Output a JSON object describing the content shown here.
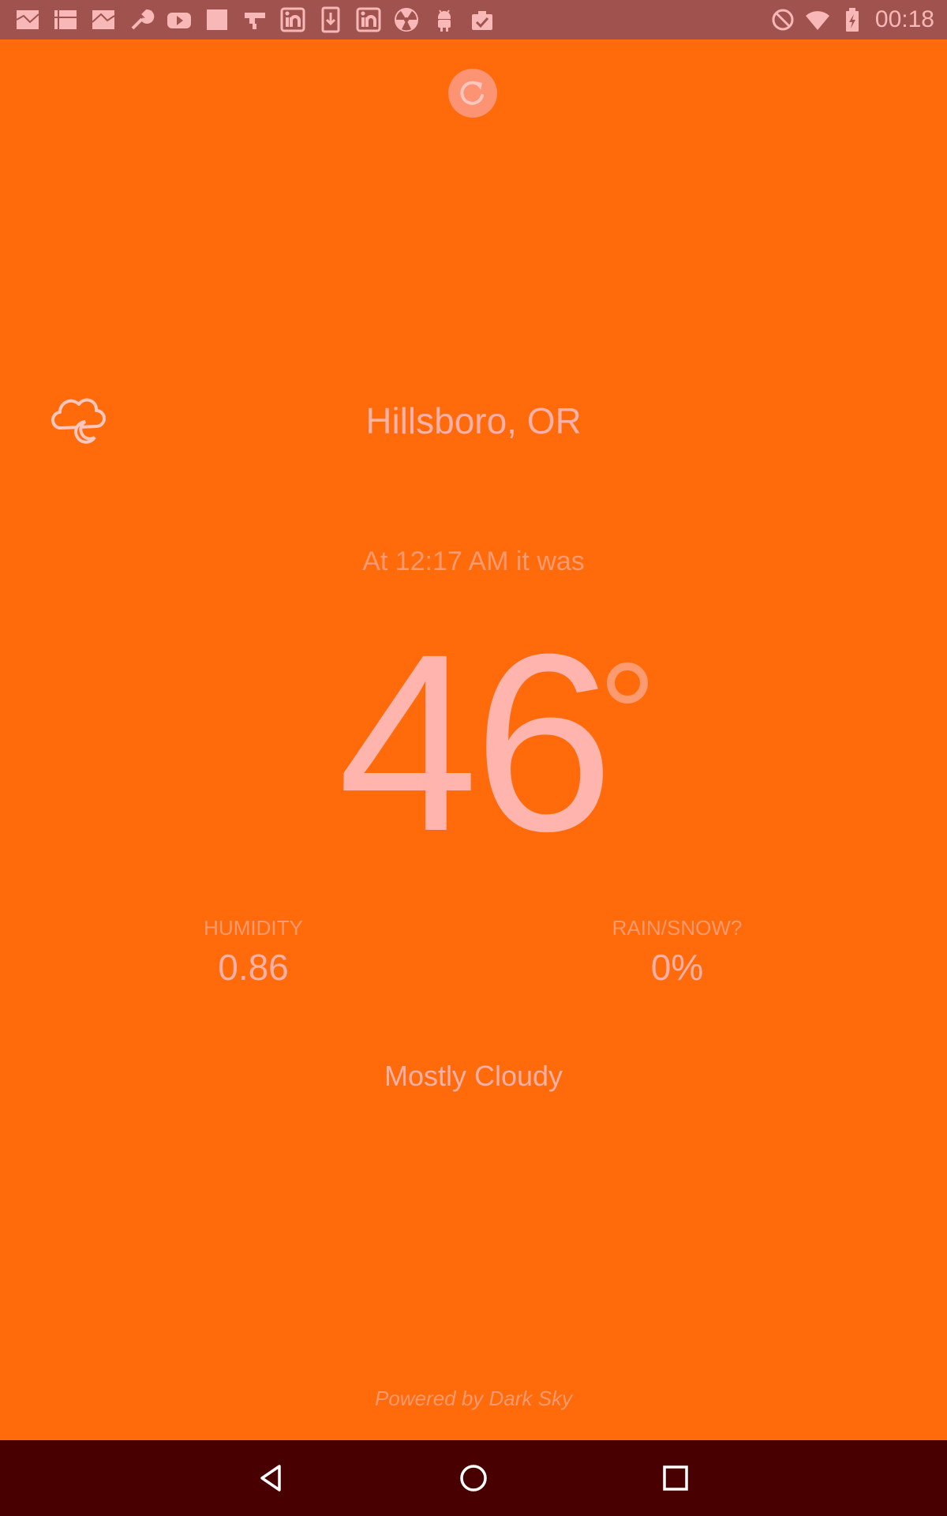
{
  "status_bar": {
    "time": "00:18",
    "notification_icons": [
      "photo-collage-icon",
      "photo-collage-icon",
      "photo-collage-icon",
      "wrench-icon",
      "youtube-icon",
      "square-icon",
      "tool-icon",
      "linkedin-icon",
      "download-icon",
      "linkedin-icon",
      "radiation-icon",
      "android-icon",
      "clipboard-check-icon"
    ],
    "system_icons": [
      "do-not-disturb-icon",
      "wifi-icon",
      "battery-charging-icon"
    ]
  },
  "weather": {
    "location": "Hillsboro, OR",
    "time_label": "At 12:17 AM it was",
    "temperature": "46",
    "icon": "cloudy-night-icon",
    "humidity_label": "HUMIDITY",
    "humidity_value": "0.86",
    "precip_label": "RAIN/SNOW?",
    "precip_value": "0%",
    "summary": "Mostly Cloudy",
    "attribution": "Powered by Dark Sky"
  },
  "colors": {
    "background": "#FF6B0A",
    "status_bar": "#A0524F",
    "nav_bar": "#480000",
    "text_primary": "#FFB0A8",
    "text_secondary": "#FD9A6F"
  },
  "navigation": {
    "buttons": [
      "back-icon",
      "home-icon",
      "recents-icon"
    ]
  }
}
